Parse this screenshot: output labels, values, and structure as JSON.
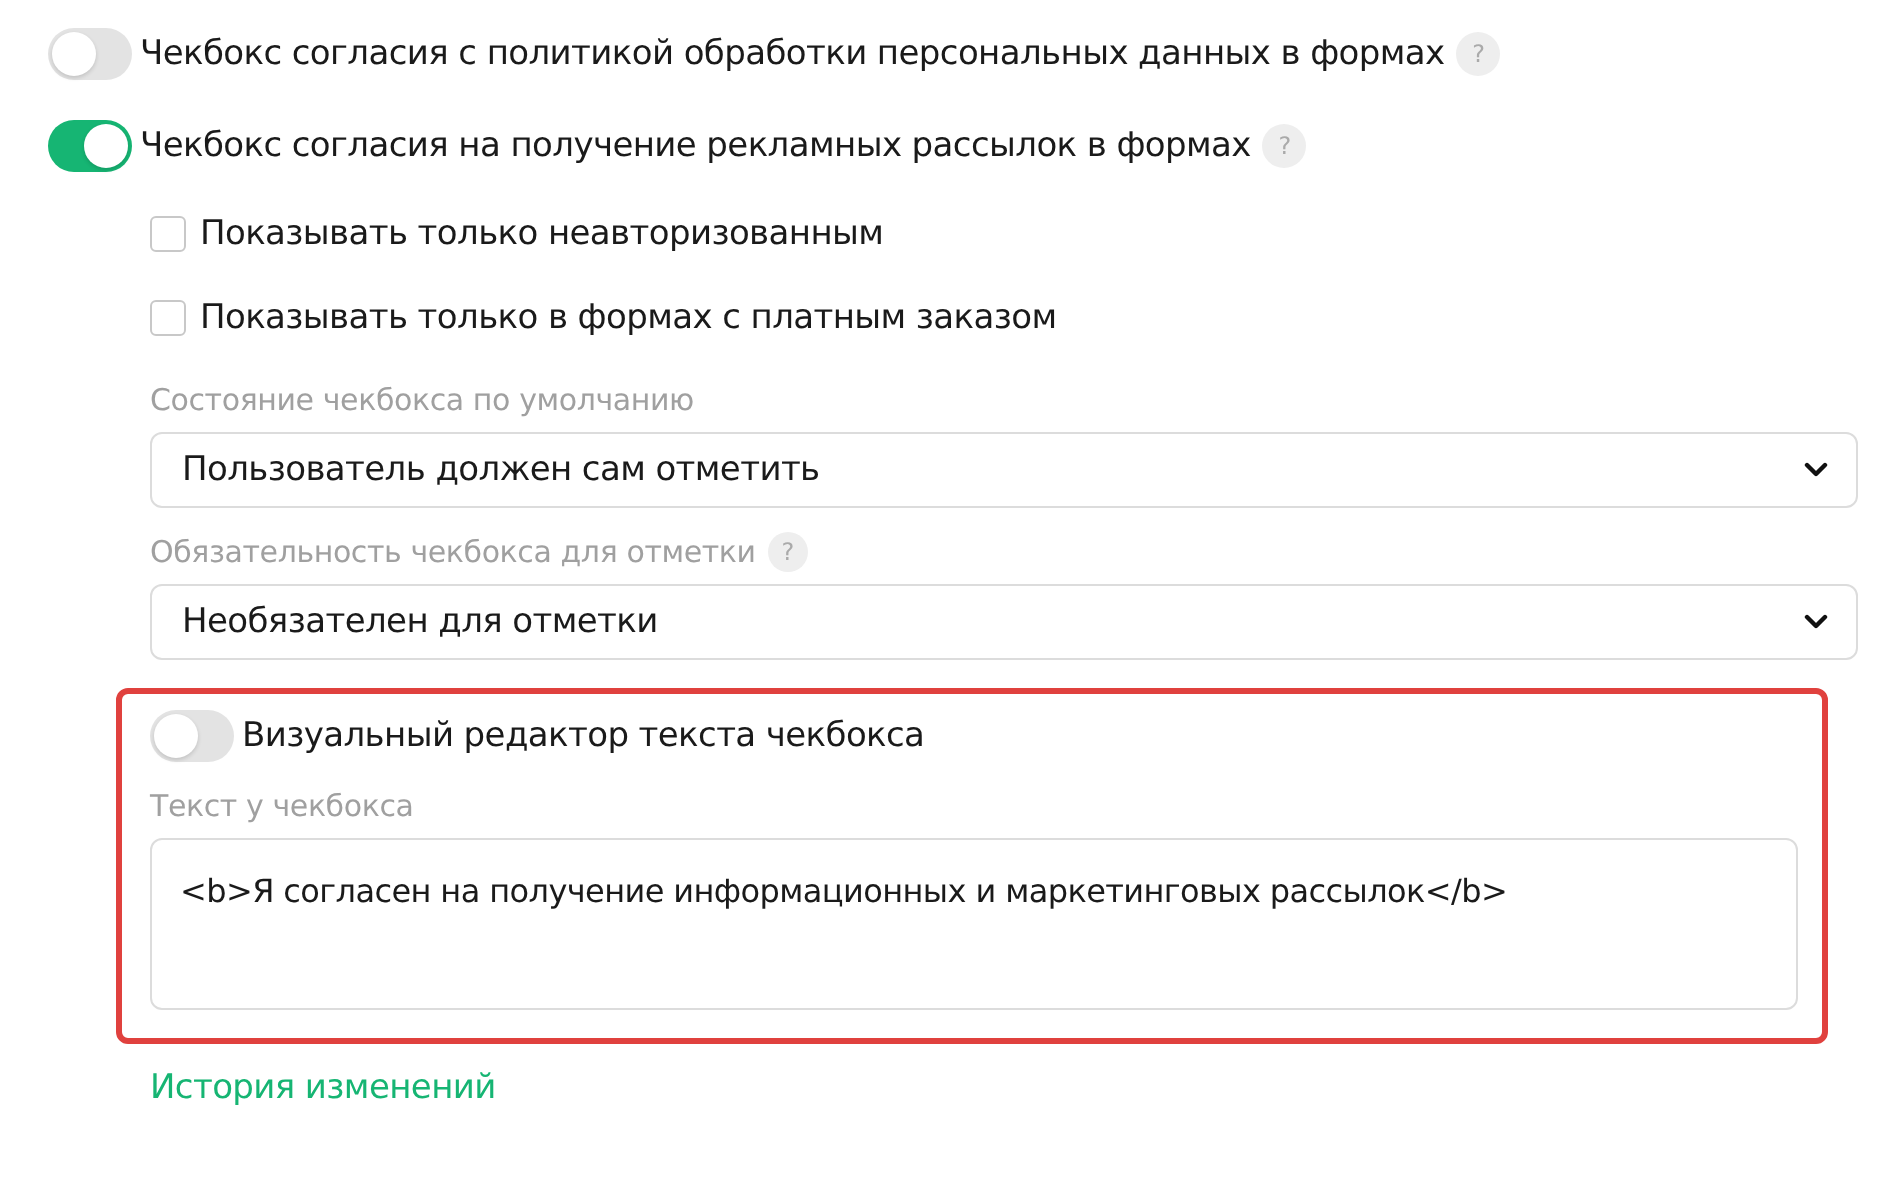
{
  "toggles": [
    {
      "label": "Чекбокс согласия с политикой обработки персональных данных в формах",
      "on": false,
      "help": "?"
    },
    {
      "label": "Чекбокс согласия на получение рекламных рассылок в формах",
      "on": true,
      "help": "?"
    }
  ],
  "options": [
    {
      "label": "Показывать только неавторизованным",
      "checked": false
    },
    {
      "label": "Показывать только в формах с платным заказом",
      "checked": false
    }
  ],
  "selects": [
    {
      "label": "Состояние чекбокса по умолчанию",
      "value": "Пользователь должен сам отметить"
    },
    {
      "label": "Обязательность чекбокса для отметки",
      "help": "?",
      "value": "Необязателен для отметки"
    }
  ],
  "highlighted": {
    "toggle": {
      "label": "Визуальный редактор текста чекбокса",
      "on": false
    },
    "text_label": "Текст у чекбокса",
    "text_value": "<b>Я согласен на получение информационных и маркетинговых рассылок</b>"
  },
  "history_link": "История изменений"
}
